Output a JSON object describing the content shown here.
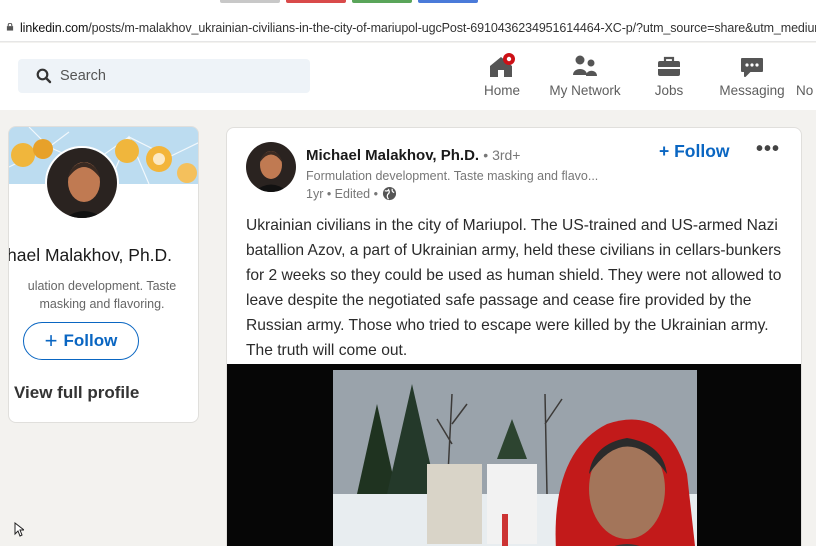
{
  "browser": {
    "url_host": "linkedin.com",
    "url_rest": "/posts/m-malakhov_ukrainian-civilians-in-the-city-of-mariupol-ugcPost-6910436234951614464-XC-p/?utm_source=share&utm_medium="
  },
  "nav": {
    "search_placeholder": "Search",
    "items": [
      {
        "label": "Home",
        "icon": "home-icon"
      },
      {
        "label": "My Network",
        "icon": "network-icon"
      },
      {
        "label": "Jobs",
        "icon": "briefcase-icon"
      },
      {
        "label": "Messaging",
        "icon": "messaging-icon"
      },
      {
        "label": "No",
        "icon": "notifications-icon"
      }
    ]
  },
  "profile_card": {
    "name": "hael Malakhov, Ph.D.",
    "headline": "ulation development. Taste masking and flavoring.",
    "follow_label": "Follow",
    "view_profile_label": "View full profile"
  },
  "post": {
    "author": "Michael Malakhov, Ph.D.",
    "degree": "• 3rd+",
    "headline": "Formulation development. Taste masking and flavo...",
    "meta": "1yr • Edited •",
    "follow_label": "Follow",
    "more_label": "•••",
    "text": "Ukrainian civilians in the city of Mariupol. The US-trained and US-armed Nazi batallion Azov, a part of Ukrainian army, held these civilians in cellars-bunkers for 2 weeks so they could be used as human shield. They were not allowed to leave despite the negotiated safe passage and cease fire provided by the Russian army. Those who tried to escape were killed by the Ukrainian army. The truth will come out."
  },
  "colors": {
    "linkedin_blue": "#0a66c2",
    "notification_red": "#cc1016",
    "page_bg": "#f3f2ef"
  }
}
